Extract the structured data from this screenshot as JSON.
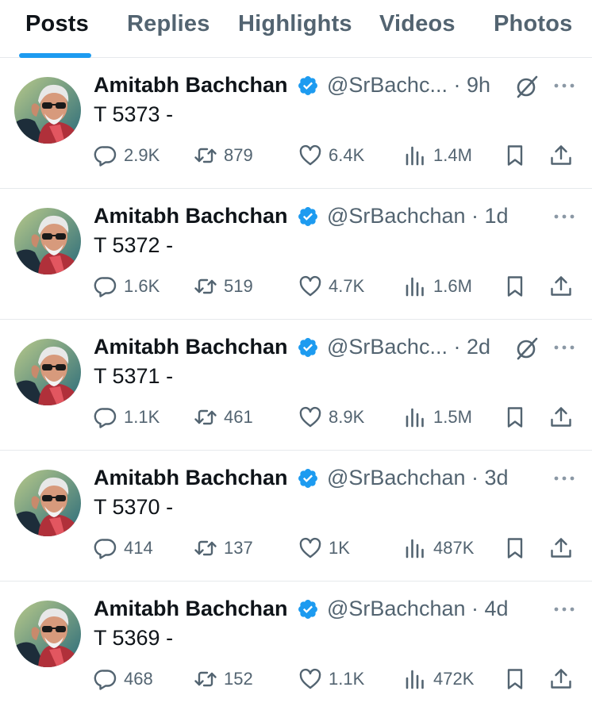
{
  "tabs": [
    {
      "label": "Posts",
      "active": true
    },
    {
      "label": "Replies",
      "active": false
    },
    {
      "label": "Highlights",
      "active": false
    },
    {
      "label": "Videos",
      "active": false
    },
    {
      "label": "Photos",
      "active": false
    }
  ],
  "colors": {
    "accent": "#1d9bf0",
    "text_primary": "#0f1419",
    "text_secondary": "#536471",
    "divider": "#e6e9ec"
  },
  "icons": {
    "reply": "speech-bubble-icon",
    "repost": "repost-arrows-icon",
    "like": "heart-icon",
    "views": "bar-chart-icon",
    "bookmark": "bookmark-icon",
    "share": "share-upload-icon",
    "verified": "verified-badge-icon",
    "grok": "grok-slash-icon",
    "more": "more-dots-icon"
  },
  "posts": [
    {
      "name": "Amitabh Bachchan",
      "handle_time": "@SrBachc... · 9h",
      "text": "T 5373 -",
      "replies": "2.9K",
      "reposts": "879",
      "likes": "6.4K",
      "views": "1.4M",
      "has_grok": true
    },
    {
      "name": "Amitabh Bachchan",
      "handle_time": "@SrBachchan · 1d",
      "text": "T 5372 -",
      "replies": "1.6K",
      "reposts": "519",
      "likes": "4.7K",
      "views": "1.6M",
      "has_grok": false
    },
    {
      "name": "Amitabh Bachchan",
      "handle_time": "@SrBachc... · 2d",
      "text": "T 5371 -",
      "replies": "1.1K",
      "reposts": "461",
      "likes": "8.9K",
      "views": "1.5M",
      "has_grok": true
    },
    {
      "name": "Amitabh Bachchan",
      "handle_time": "@SrBachchan · 3d",
      "text": "T 5370 -",
      "replies": "414",
      "reposts": "137",
      "likes": "1K",
      "views": "487K",
      "has_grok": false
    },
    {
      "name": "Amitabh Bachchan",
      "handle_time": "@SrBachchan · 4d",
      "text": "T 5369 -",
      "replies": "468",
      "reposts": "152",
      "likes": "1.1K",
      "views": "472K",
      "has_grok": false
    }
  ]
}
